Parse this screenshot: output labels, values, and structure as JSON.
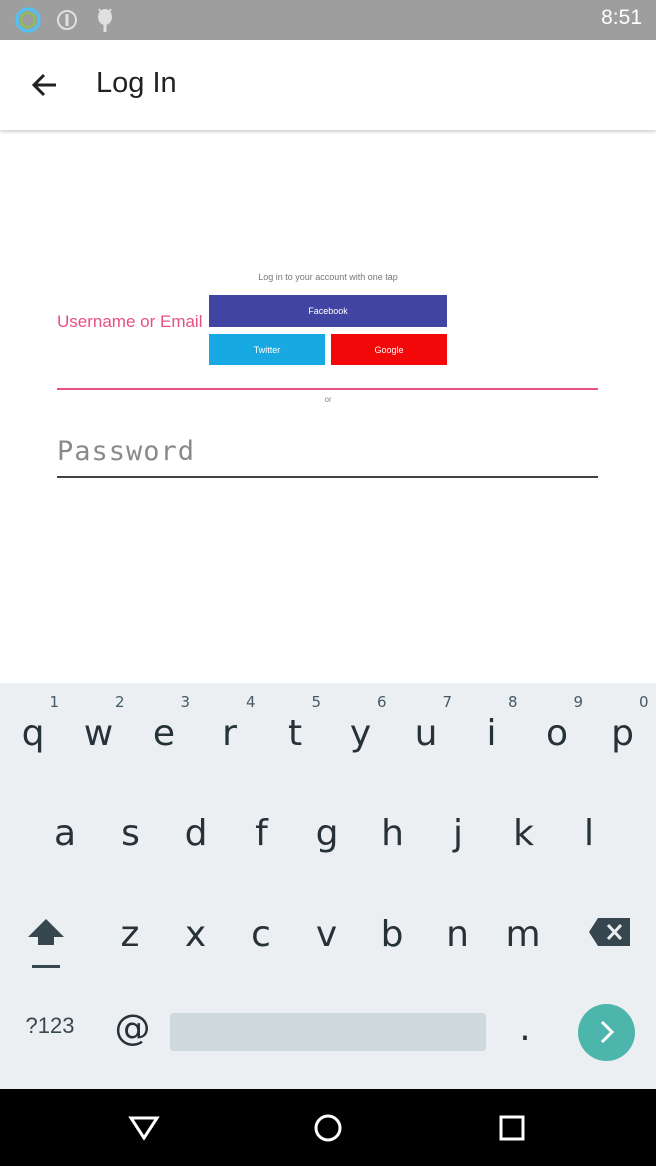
{
  "status_bar": {
    "time": "8:51",
    "icons": [
      "ring-icon",
      "alert-icon",
      "android-icon"
    ]
  },
  "app_bar": {
    "title": "Log In",
    "back_icon": "arrow-left-icon"
  },
  "social_login": {
    "prompt": "Log in to your account with one tap",
    "facebook": "Facebook",
    "twitter": "Twitter",
    "google": "Google",
    "or_text": "or",
    "colors": {
      "facebook": "#4144a3",
      "twitter": "#18a9e3",
      "google": "#f20808"
    }
  },
  "form": {
    "username_label": "Username or Email",
    "password_placeholder": "Password",
    "accent_color": "#e8507f"
  },
  "keyboard": {
    "row1": [
      {
        "key": "q",
        "hint": "1"
      },
      {
        "key": "w",
        "hint": "2"
      },
      {
        "key": "e",
        "hint": "3"
      },
      {
        "key": "r",
        "hint": "4"
      },
      {
        "key": "t",
        "hint": "5"
      },
      {
        "key": "y",
        "hint": "6"
      },
      {
        "key": "u",
        "hint": "7"
      },
      {
        "key": "i",
        "hint": "8"
      },
      {
        "key": "o",
        "hint": "9"
      },
      {
        "key": "p",
        "hint": "0"
      }
    ],
    "row2": [
      "a",
      "s",
      "d",
      "f",
      "g",
      "h",
      "j",
      "k",
      "l"
    ],
    "row3": [
      "z",
      "x",
      "c",
      "v",
      "b",
      "n",
      "m"
    ],
    "symbols_key": "?123",
    "at_key": "@",
    "period_key": ".",
    "go_color": "#4db6ac"
  },
  "nav_bar": {
    "icons": [
      "back-triangle-icon",
      "home-circle-icon",
      "recents-square-icon"
    ]
  }
}
